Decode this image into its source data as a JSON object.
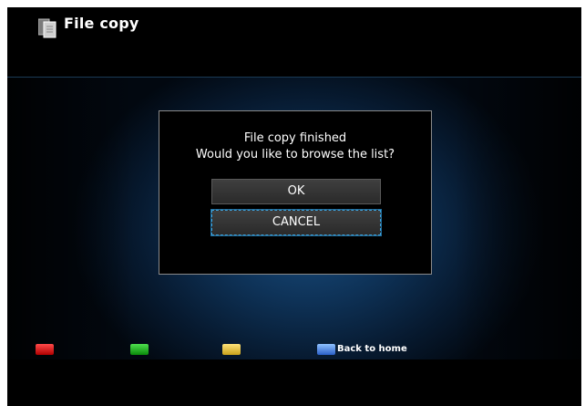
{
  "header": {
    "title": "File copy",
    "icon": "file-copy-icon"
  },
  "dialog": {
    "message_line1": "File copy finished",
    "message_line2": "Would you like to browse the list?",
    "ok_label": "OK",
    "cancel_label": "CANCEL",
    "focused": "CANCEL"
  },
  "color_keys": {
    "red": {
      "color": "#d81818",
      "label": ""
    },
    "green": {
      "color": "#22b022",
      "label": ""
    },
    "yellow": {
      "color": "#e0c040",
      "label": ""
    },
    "blue": {
      "color": "#4a86e0",
      "label": "Back to home"
    }
  },
  "colors": {
    "background": "#000000",
    "accent_blue": "#1a4f82",
    "focus_border": "#3fa0d8"
  }
}
